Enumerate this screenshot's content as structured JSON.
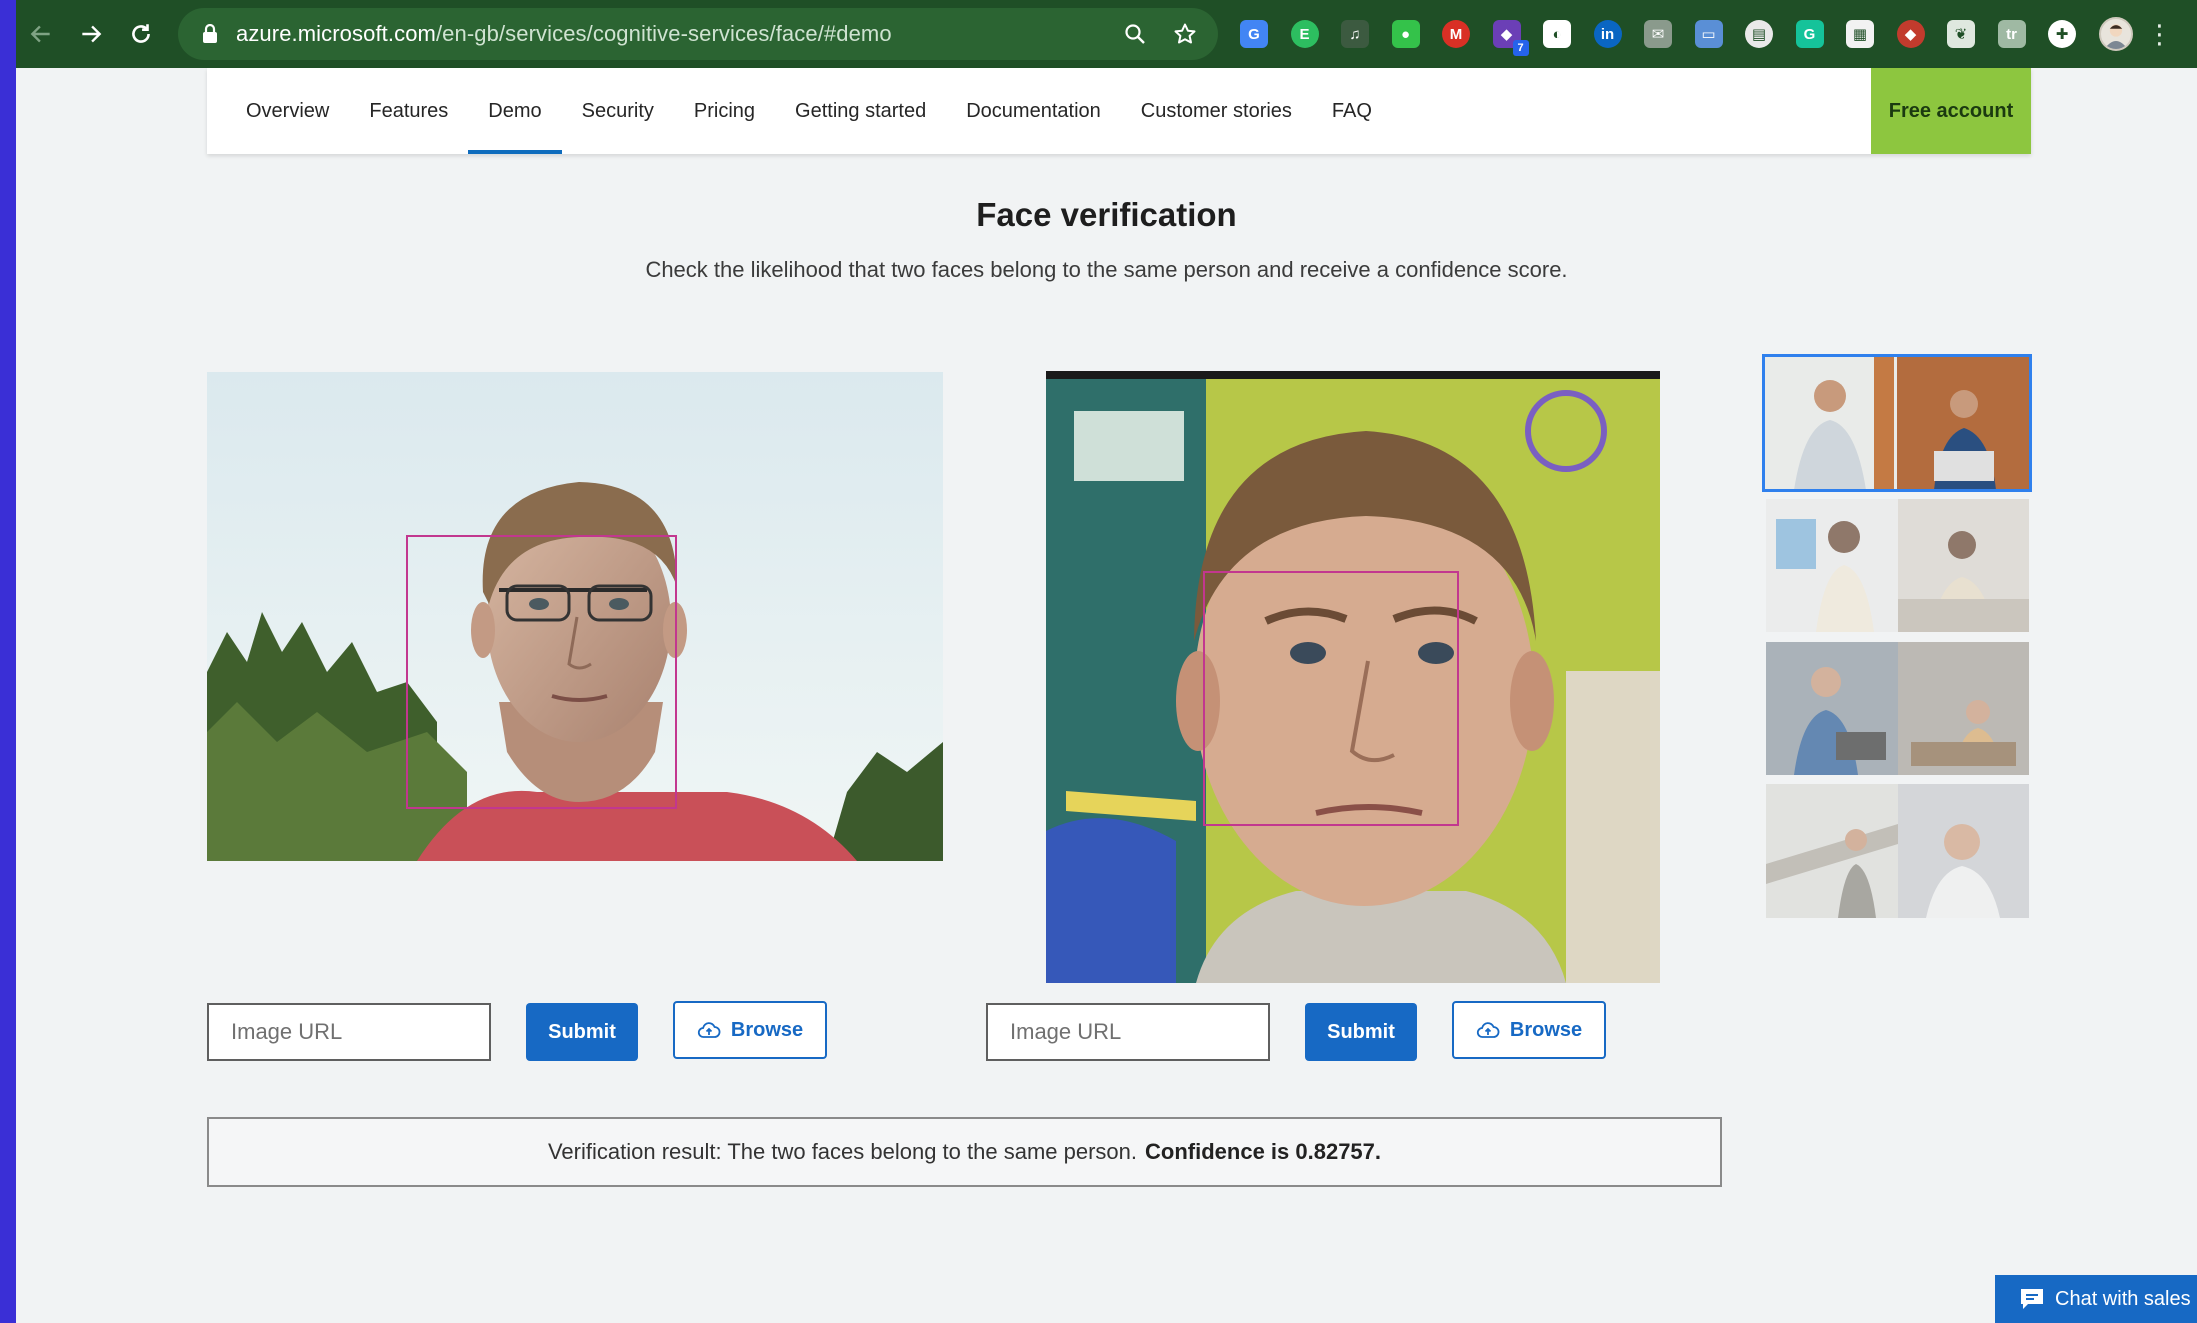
{
  "browser": {
    "url_host": "azure.microsoft.com",
    "url_path": "/en-gb/services/cognitive-services/face/#demo",
    "extensions": [
      {
        "icon": "google-translate-icon",
        "color": "#4285f4",
        "glyph": "G"
      },
      {
        "icon": "evernote-icon",
        "color": "#2dbe60",
        "glyph": "E"
      },
      {
        "icon": "headphones-icon",
        "color": "#3c5a40",
        "glyph": "♫"
      },
      {
        "icon": "green-dot-icon",
        "color": "#34c24a",
        "glyph": "●"
      },
      {
        "icon": "gmail-icon",
        "color": "#d93025",
        "glyph": "M"
      },
      {
        "icon": "badge-extension-icon",
        "color": "#6b3fb6",
        "glyph": "◆",
        "badge": "7"
      },
      {
        "icon": "circle-extension-icon",
        "color": "#ffffff",
        "glyph": "◐"
      },
      {
        "icon": "linkedin-icon",
        "color": "#0a66c2",
        "glyph": "in"
      },
      {
        "icon": "mail-icon",
        "color": "#8a9a8c",
        "glyph": "✉"
      },
      {
        "icon": "screen-extension-icon",
        "color": "#5a8fd6",
        "glyph": "▭"
      },
      {
        "icon": "card-extension-icon",
        "color": "#e9e9e9",
        "glyph": "▤"
      },
      {
        "icon": "grammarly-icon",
        "color": "#15c39a",
        "glyph": "G"
      },
      {
        "icon": "note-extension-icon",
        "color": "#f2f2f2",
        "glyph": "▦"
      },
      {
        "icon": "shield-extension-icon",
        "color": "#c23b2d",
        "glyph": "◆"
      },
      {
        "icon": "leaf-extension-icon",
        "color": "#dfe8df",
        "glyph": "❦"
      },
      {
        "icon": "tr-extension-icon",
        "color": "#9fb9a3",
        "glyph": "tr"
      },
      {
        "icon": "puzzle-icon",
        "color": "#ffffff",
        "glyph": "✚"
      }
    ]
  },
  "nav": {
    "items": [
      "Overview",
      "Features",
      "Demo",
      "Security",
      "Pricing",
      "Getting started",
      "Documentation",
      "Customer stories",
      "FAQ"
    ],
    "active_index": 2,
    "free_account": "Free account"
  },
  "header": {
    "title": "Face verification",
    "subtitle": "Check the likelihood that two faces belong to the same person and receive a confidence score."
  },
  "inputs": {
    "left": {
      "placeholder": "Image URL",
      "submit": "Submit",
      "browse": "Browse"
    },
    "right": {
      "placeholder": "Image URL",
      "submit": "Submit",
      "browse": "Browse"
    }
  },
  "result": {
    "text": "Verification result: The two faces belong to the same person.",
    "confidence": "Confidence is 0.82757."
  },
  "chat": {
    "label": "Chat with sales"
  },
  "colors": {
    "browser_bar": "#1f4f26",
    "accent": "#1769c4",
    "free_account_bg": "#8dc63f",
    "face_box": "#c2378f",
    "page_bg": "#f1f3f4",
    "frame": "#3a2fd6"
  }
}
